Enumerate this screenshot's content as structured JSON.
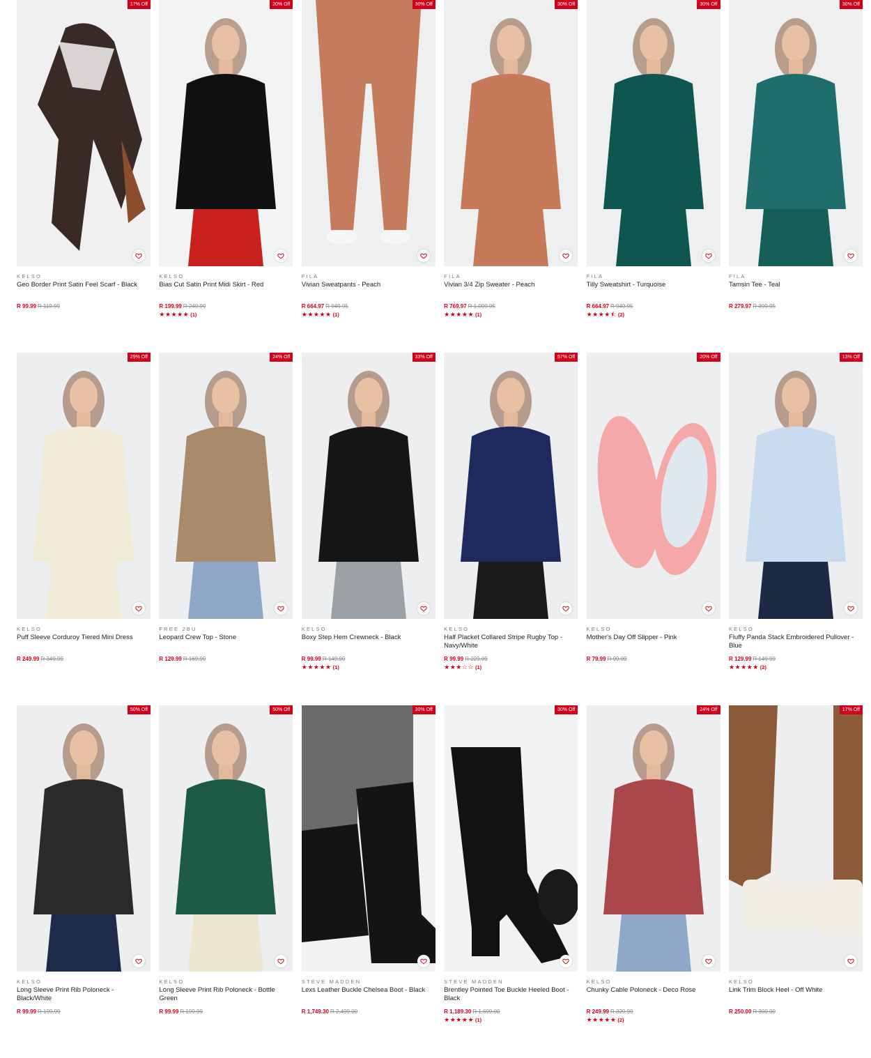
{
  "colors": {
    "accent": "#d0021b",
    "image_bg": "#eceeef"
  },
  "rows": [
    [
      {
        "badge": "17% Off",
        "brand": "KELSO",
        "name": "Geo Border Print Satin Feel Scarf - Black",
        "price": "R 99.99",
        "was": "R 119.99",
        "stars": "",
        "count": "",
        "image": "scarf",
        "palette": [
          "#f1f0f0",
          "#3a2a26",
          "#8a4e2f"
        ]
      },
      {
        "badge": "20% Off",
        "brand": "KELSO",
        "name": "Bias Cut Satin Print Midi Skirt - Red",
        "price": "R 199.99",
        "was": "R 249.99",
        "stars": "★★★★★",
        "count": "(1)",
        "image": "model",
        "palette": [
          "#f2f3f3",
          "#111111",
          "#c9221e"
        ]
      },
      {
        "badge": "30% Off",
        "brand": "FILA",
        "name": "Vivian Sweatpants - Peach",
        "price": "R 664.97",
        "was": "R 949.95",
        "stars": "★★★★★",
        "count": "(1)",
        "image": "pants",
        "palette": [
          "#eef0f0",
          "#c57c5c",
          "#c57c5c"
        ]
      },
      {
        "badge": "30% Off",
        "brand": "FILA",
        "name": "Vivian 3/4 Zip Sweater - Peach",
        "price": "R 769.97",
        "was": "R 1,099.95",
        "stars": "★★★★★",
        "count": "(1)",
        "image": "model",
        "palette": [
          "#eef0f0",
          "#c77a5a",
          "#c77a5a"
        ]
      },
      {
        "badge": "30% Off",
        "brand": "FILA",
        "name": "Tilly Sweatshirt - Turquoise",
        "price": "R 664.97",
        "was": "R 949.95",
        "stars": "★★★★⯪",
        "count": "(2)",
        "image": "model",
        "palette": [
          "#eef0f0",
          "#0f5650",
          "#0f5650"
        ]
      },
      {
        "badge": "30% Off",
        "brand": "FILA",
        "name": "Tamsin Tee - Teal",
        "price": "R 279.97",
        "was": "R 399.95",
        "stars": "",
        "count": "",
        "image": "model",
        "palette": [
          "#eef0f0",
          "#1f6d6d",
          "#155f58"
        ]
      }
    ],
    [
      {
        "badge": "29% Off",
        "brand": "KELSO",
        "name": "Puff Sleeve Corduroy Tiered Mini Dress",
        "price": "R 249.99",
        "was": "R 349.99",
        "stars": "",
        "count": "",
        "image": "model",
        "palette": [
          "#eceeef",
          "#f1ecd8",
          "#f1ecd8"
        ]
      },
      {
        "badge": "24% Off",
        "brand": "FREE 2BU",
        "name": "Leopard Crew Top - Stone",
        "price": "R 129.99",
        "was": "R 169.99",
        "stars": "",
        "count": "",
        "image": "model",
        "palette": [
          "#eceeef",
          "#a98a6a",
          "#8ea9c7"
        ]
      },
      {
        "badge": "33% Off",
        "brand": "KELSO",
        "name": "Boxy Step Hem Crewneck - Black",
        "price": "R 99.99",
        "was": "R 149.99",
        "stars": "★★★★★",
        "count": "(1)",
        "image": "model",
        "palette": [
          "#eceeef",
          "#151515",
          "#9aa0a3"
        ]
      },
      {
        "badge": "57% Off",
        "brand": "KELSO",
        "name": "Half Placket Collared Stripe Rugby Top - Navy/White",
        "price": "R 99.99",
        "was": "R 229.99",
        "stars": "★★★☆☆",
        "count": "(1)",
        "image": "model",
        "palette": [
          "#eceeef",
          "#1e2a5e",
          "#1a1a1a"
        ]
      },
      {
        "badge": "20% Off",
        "brand": "KELSO",
        "name": "Mother's Day Off Slipper - Pink",
        "price": "R 79.99",
        "was": "R 99.99",
        "stars": "",
        "count": "",
        "image": "slippers",
        "palette": [
          "#eceeef",
          "#f4a9a8",
          "#f4a9a8"
        ]
      },
      {
        "badge": "13% Off",
        "brand": "KELSO",
        "name": "Fluffy Panda Stack Embroidered Pullover - Blue",
        "price": "R 129.99",
        "was": "R 149.99",
        "stars": "★★★★★",
        "count": "(2)",
        "image": "model",
        "palette": [
          "#eceeef",
          "#c9dcef",
          "#1c2a45"
        ]
      }
    ],
    [
      {
        "badge": "50% Off",
        "brand": "KELSO",
        "name": "Long Sleeve Print Rib Poloneck - Black/White",
        "price": "R 99.99",
        "was": "R 199.99",
        "stars": "",
        "count": "",
        "image": "model",
        "palette": [
          "#eceeef",
          "#2a2a2a",
          "#1d2a48"
        ]
      },
      {
        "badge": "50% Off",
        "brand": "KELSO",
        "name": "Long Sleeve Print Rib Poloneck - Bottle Green",
        "price": "R 99.99",
        "was": "R 199.99",
        "stars": "",
        "count": "",
        "image": "model",
        "palette": [
          "#eceeef",
          "#1d5a44",
          "#efe6d2"
        ]
      },
      {
        "badge": "30% Off",
        "brand": "STEVE MADDEN",
        "name": "Lexs Leather Buckle Chelsea Boot - Black",
        "price": "R 1,749.30",
        "was": "R 2,499.00",
        "stars": "",
        "count": "",
        "image": "boots",
        "palette": [
          "#f1f2f2",
          "#141414",
          "#6a6a6a"
        ]
      },
      {
        "badge": "30% Off",
        "brand": "STEVE MADDEN",
        "name": "Brentley Pointed Toe Buckle Heeled Boot - Black",
        "price": "R 1,189.30",
        "was": "R 1,699.00",
        "stars": "★★★★★",
        "count": "(1)",
        "image": "heelboot",
        "palette": [
          "#f1f2f2",
          "#121212",
          "#121212"
        ]
      },
      {
        "badge": "24% Off",
        "brand": "KELSO",
        "name": "Chunky Cable Poloneck - Deco Rose",
        "price": "R 249.99",
        "was": "R 329.99",
        "stars": "★★★★★",
        "count": "(2)",
        "image": "model",
        "palette": [
          "#eceeef",
          "#a9474b",
          "#8ea9c7"
        ]
      },
      {
        "badge": "17% Off",
        "brand": "KELSO",
        "name": "Link Trim Block Heel - Off White",
        "price": "R 250.00",
        "was": "R 300.00",
        "stars": "",
        "count": "",
        "image": "heels",
        "palette": [
          "#eeeeee",
          "#8a5a3a",
          "#f3eee3"
        ]
      }
    ]
  ]
}
